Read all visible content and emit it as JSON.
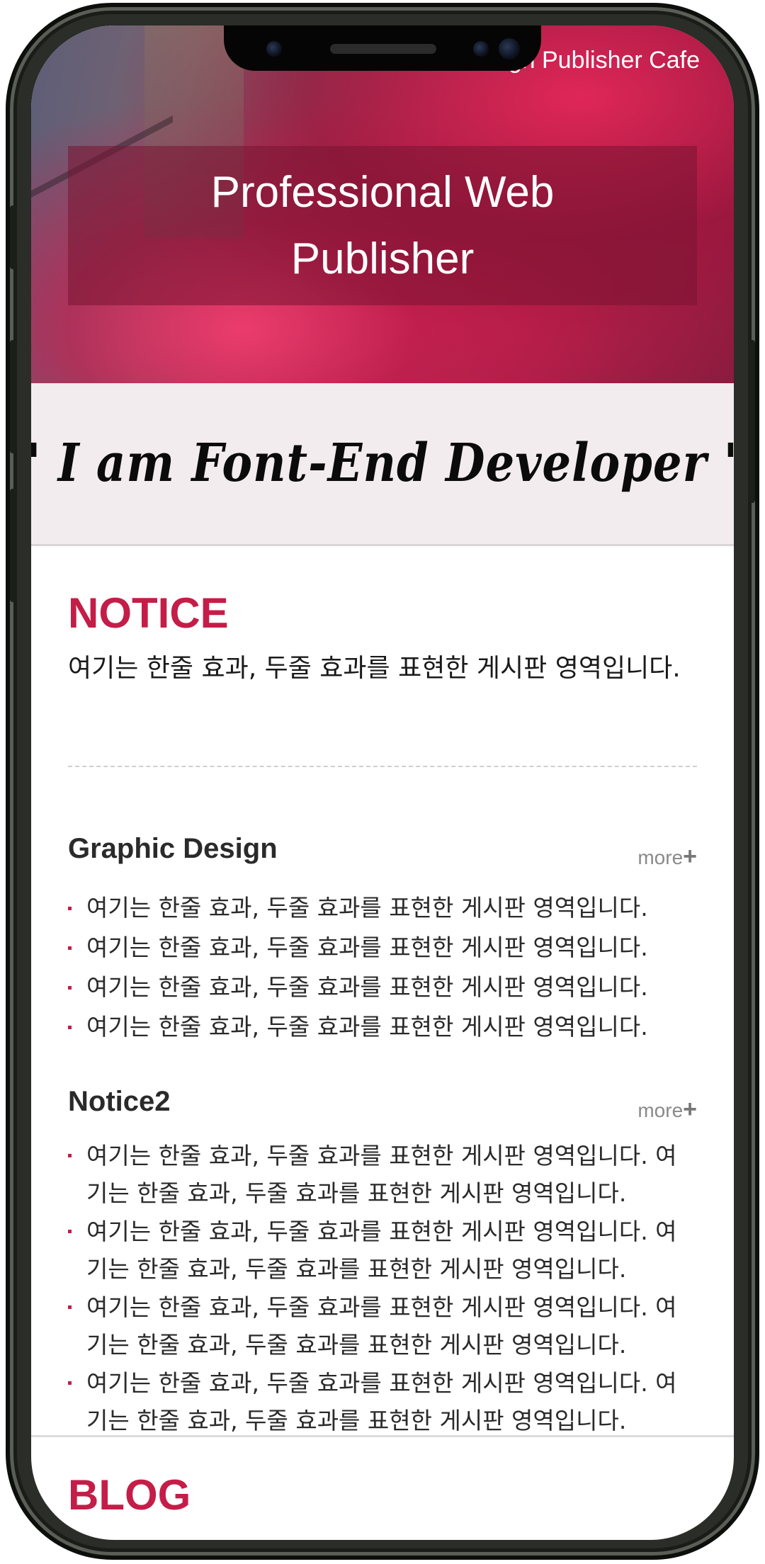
{
  "header": {
    "nav_text": "Design Publisher Cafe"
  },
  "hero": {
    "title": "Professional Web Publisher"
  },
  "quote": {
    "text": "\" I am Font-End Developer \""
  },
  "notice": {
    "title": "NOTICE",
    "description": "여기는 한줄 효과, 두줄 효과를 표현한 게시판 영역입니다."
  },
  "graphic_design": {
    "title": "Graphic Design",
    "more_label": "more",
    "items": [
      "여기는 한줄 효과, 두줄 효과를 표현한 게시판 영역입니다.",
      "여기는 한줄 효과, 두줄 효과를 표현한 게시판 영역입니다.",
      "여기는 한줄 효과, 두줄 효과를 표현한 게시판 영역입니다.",
      "여기는 한줄 효과, 두줄 효과를 표현한 게시판 영역입니다."
    ]
  },
  "notice2": {
    "title": "Notice2",
    "more_label": "more",
    "items": [
      "여기는 한줄 효과, 두줄 효과를 표현한 게시판 영역입니다. 여기는 한줄 효과, 두줄 효과를 표현한 게시판 영역입니다.",
      "여기는 한줄 효과, 두줄 효과를 표현한 게시판 영역입니다. 여기는 한줄 효과, 두줄 효과를 표현한 게시판 영역입니다.",
      "여기는 한줄 효과, 두줄 효과를 표현한 게시판 영역입니다. 여기는 한줄 효과, 두줄 효과를 표현한 게시판 영역입니다.",
      "여기는 한줄 효과, 두줄 효과를 표현한 게시판 영역입니다. 여기는 한줄 효과, 두줄 효과를 표현한 게시판 영역입니다."
    ]
  },
  "blog": {
    "title": "BLOG"
  },
  "colors": {
    "accent": "#c41d48",
    "quote_bg": "#f3ecef"
  },
  "icons": {
    "more": "plus-icon"
  }
}
